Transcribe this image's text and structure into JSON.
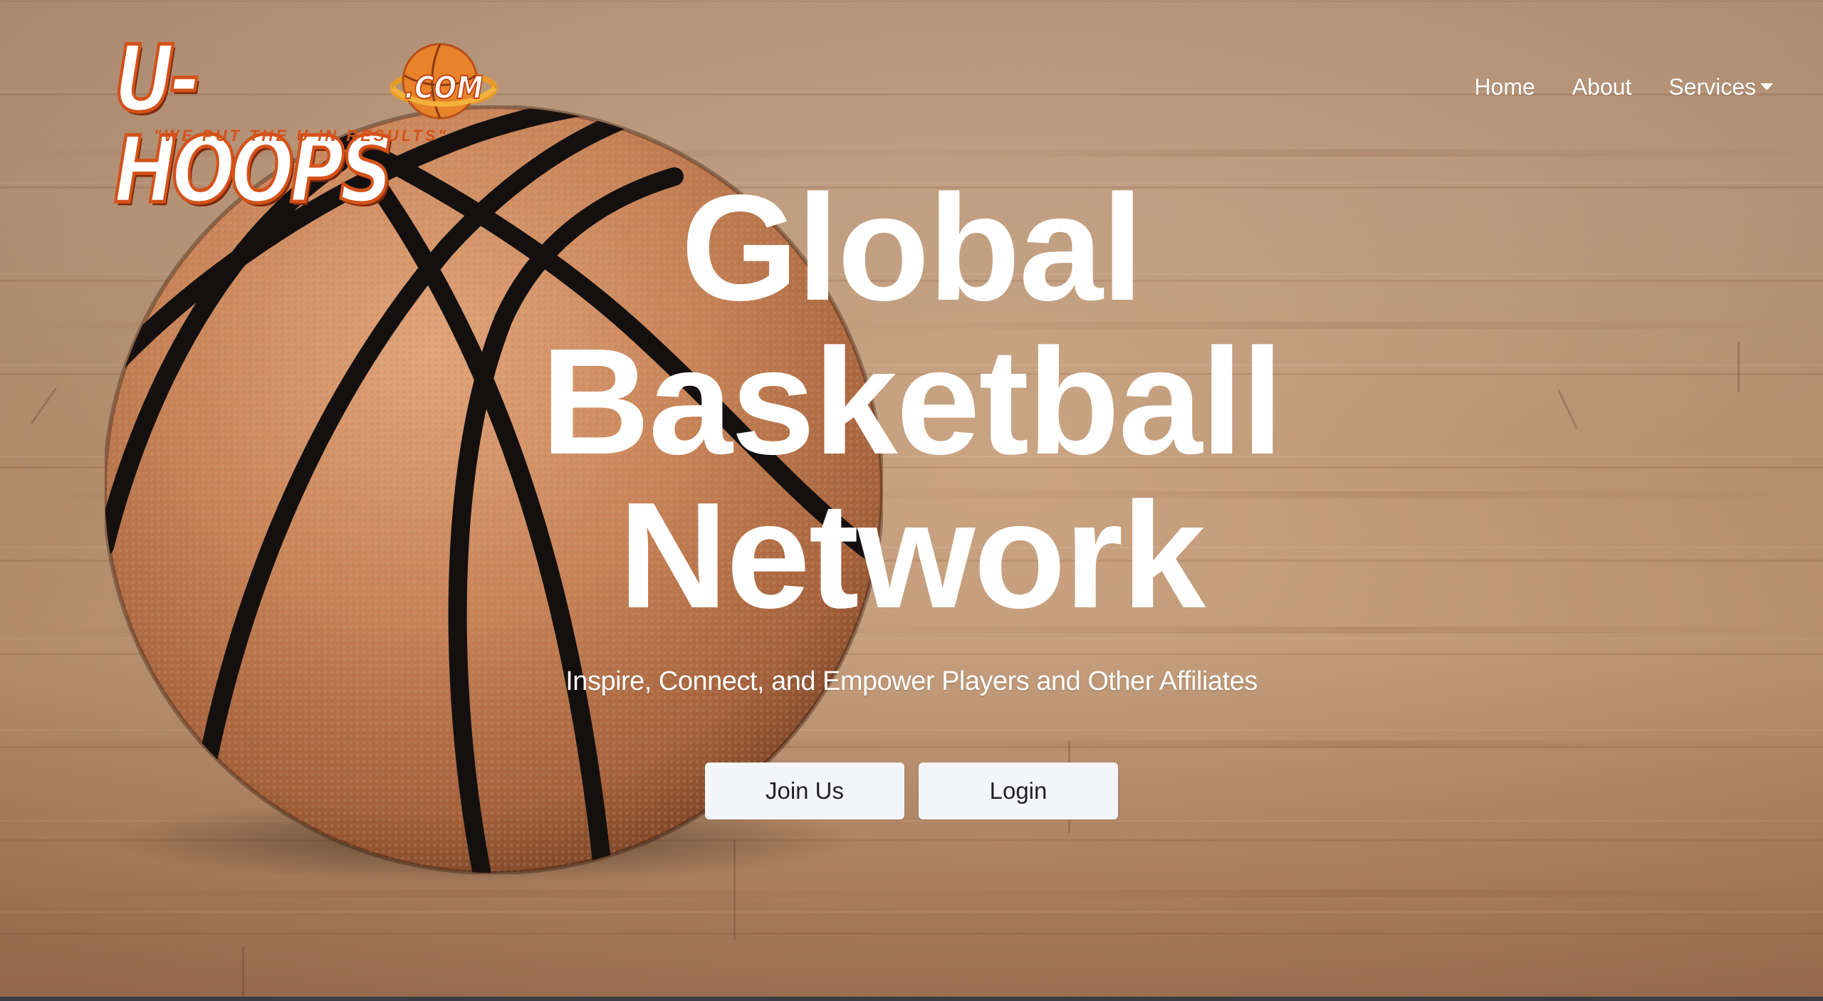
{
  "brand": {
    "logo_text": "U-HOOPS",
    "logo_domain": ".COM",
    "tagline": "\"WE PUT THE U IN RESULTS\""
  },
  "nav": {
    "items": [
      {
        "label": "Home"
      },
      {
        "label": "About"
      },
      {
        "label": "Services"
      }
    ]
  },
  "hero": {
    "title_lines": [
      "Global",
      "Basketball",
      "Network"
    ],
    "subtitle": "Inspire, Connect, and Empower Players and Other Affiliates",
    "buttons": {
      "join": "Join Us",
      "login": "Login"
    }
  },
  "colors": {
    "logo_orange": "#d4521a",
    "button_bg": "#f4f5f8",
    "text_white": "#ffffff",
    "bottom_bar": "#3b3d43"
  }
}
